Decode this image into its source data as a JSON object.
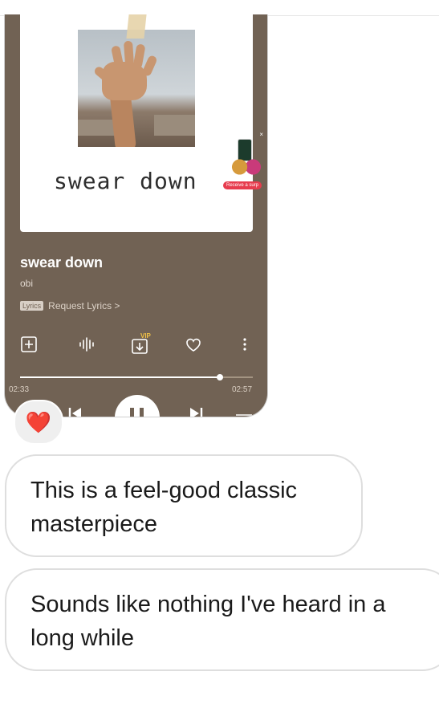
{
  "shared_card": {
    "cover_text": "swear down",
    "ad": {
      "close": "×",
      "label": "Receive a surp"
    },
    "song_title": "swear down",
    "artist": "obi",
    "lyrics_badge": "Lyrics",
    "lyrics_link": "Request Lyrics >",
    "vip_badge": "VIP",
    "current_time": "02:33",
    "duration": "02:57",
    "progress_fraction": 0.86
  },
  "reaction": {
    "emoji": "❤️"
  },
  "messages": [
    {
      "text": "This is a feel-good classic masterpiece"
    },
    {
      "text": "Sounds like nothing I've heard in a long while"
    }
  ],
  "colors": {
    "card_bg": "#716254",
    "bubble_border": "#dedede",
    "reaction_bg": "#efefef",
    "heart": "#e0223a"
  }
}
